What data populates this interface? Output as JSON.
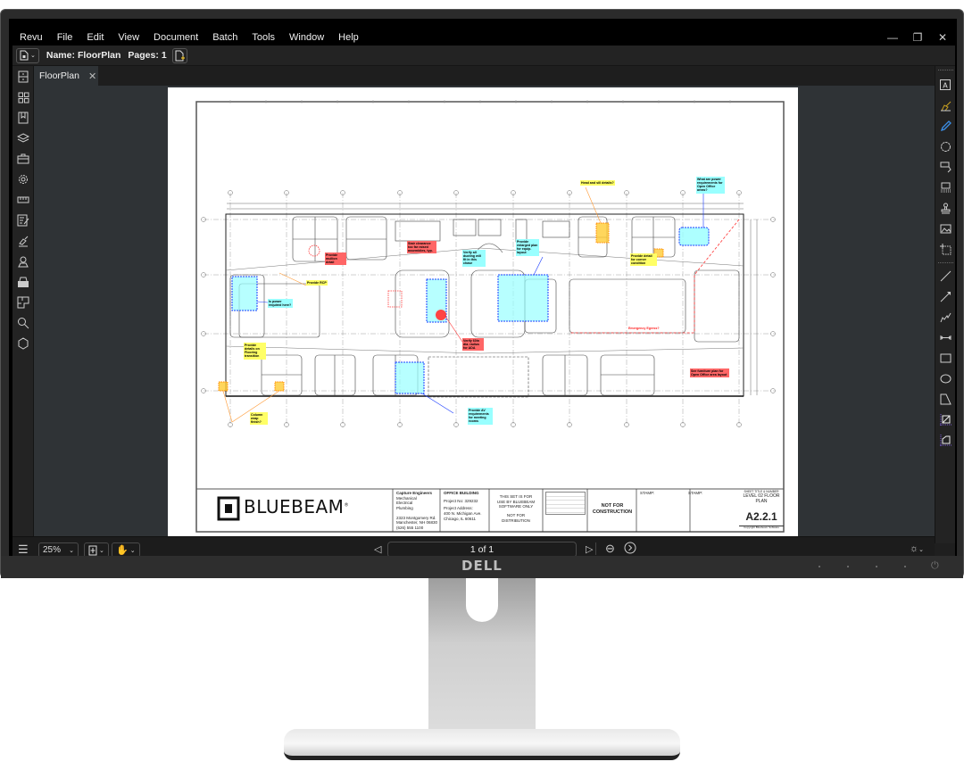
{
  "menubar": {
    "items": [
      "Revu",
      "File",
      "Edit",
      "View",
      "Document",
      "Batch",
      "Tools",
      "Window",
      "Help"
    ],
    "window_controls": {
      "minimize": "—",
      "restore": "❐",
      "close": "✕"
    }
  },
  "toolbar": {
    "name_label": "Name:",
    "name_value": "FloorPlan",
    "pages_label": "Pages:",
    "pages_value": "1"
  },
  "tabs": [
    {
      "label": "FloorPlan",
      "close": "✕"
    }
  ],
  "left_sidebar": {
    "icons": [
      "file-cabinet-icon",
      "thumbnails-icon",
      "bookmarks-icon",
      "layers-icon",
      "toolchest-icon",
      "properties-gear-icon",
      "measurements-ruler-icon",
      "markups-list-icon",
      "signatures-icon",
      "places-icon",
      "stamp-printer-icon",
      "spaces-icon",
      "search-icon",
      "studio-icon"
    ]
  },
  "right_sidebar": {
    "icons": [
      "text-box-icon",
      "highlighter-icon",
      "pen-icon",
      "cloud-icon",
      "callout-icon",
      "stamp-group-icon",
      "stamp-icon",
      "image-icon",
      "snapshot-icon",
      "line-icon",
      "arrow-icon",
      "polyline-icon",
      "dimension-icon",
      "rectangle-icon",
      "ellipse-icon",
      "polygon-icon",
      "measure-area-icon",
      "measure-perimeter-icon"
    ]
  },
  "statusbar": {
    "zoom": "25%",
    "page_display": "1 of 1"
  },
  "document": {
    "logo_text": "BLUEBEAM",
    "logo_mark": "®",
    "engineers": {
      "name": "Capture Engineers",
      "lines": [
        "Mechanical",
        "Electrical",
        "Plumbing"
      ],
      "address": [
        "2323 Montgomery Rd.",
        "Manchester, NH 06830",
        "(626) 555 1100"
      ]
    },
    "project": {
      "title": "OFFICE BUILDING",
      "number": "Project No: 329232",
      "address_label": "Project Address:",
      "address": [
        "400 N. Michigan Ave.",
        "Chicago, IL 60611"
      ]
    },
    "disclaimer": [
      "THIS SET IS FOR",
      "USE BY BLUEBEAM",
      "SOFTWARE ONLY"
    ],
    "disclaimer2": [
      "NOT FOR",
      "DISTRIBUTION"
    ],
    "not_for_construction": [
      "NOT FOR",
      "CONSTRUCTION"
    ],
    "stamp1": "STAMP:",
    "stamp2": "STAMP:",
    "sheet_title_label": "SHEET TITLE & NUMBER",
    "sheet_title": [
      "LEVEL 02 FLOOR",
      "PLAN"
    ],
    "sheet_number": "A2.2.1",
    "copyright": "Copyright Bluebeam Software",
    "markups": [
      {
        "text": "Head and sill details?",
        "color": "#ffff66"
      },
      {
        "text": "What are power requirements for Open Office areas?",
        "color": "#99ffff"
      },
      {
        "text": "Stair clearance too far raised assemblies, typ.",
        "color": "#ff6666"
      },
      {
        "text": "Provide enlarged plan for equip. layout",
        "color": "#99ffff"
      },
      {
        "text": "Verify all ducting will fit in this chase",
        "color": "#99ffff"
      },
      {
        "text": "Provide detail for corner condition",
        "color": "#ffff66"
      },
      {
        "text": "Provide mullion detail",
        "color": "#ff6666"
      },
      {
        "text": "Provide RCP",
        "color": "#ffff66"
      },
      {
        "text": "Is power required here?",
        "color": "#99ffff"
      },
      {
        "text": "Verify 60in dia. radius for ADA",
        "color": "#ff6666"
      },
      {
        "text": "Emergency Egress?",
        "color": "#ffffff"
      },
      {
        "text": "Provide details on Flooring transition",
        "color": "#ffff66"
      },
      {
        "text": "Column wrap finish?",
        "color": "#ffff66"
      },
      {
        "text": "Provide AV requirements for meeting rooms",
        "color": "#99ffff"
      },
      {
        "text": "See furniture plan for Open Office area layout",
        "color": "#ff6666"
      }
    ]
  },
  "monitor": {
    "brand": "DELL"
  },
  "colors": {
    "app_bg": "#1f1f1f",
    "canvas_bg": "#2f3336",
    "markup_yellow": "#ffff66",
    "markup_cyan": "#99ffff",
    "markup_red": "#ff6666",
    "markup_blue_border": "#1a3cff",
    "pen_blue": "#3b8fe8",
    "highlighter_gold": "#c8a020",
    "measure_purple": "#7b5bd6"
  }
}
